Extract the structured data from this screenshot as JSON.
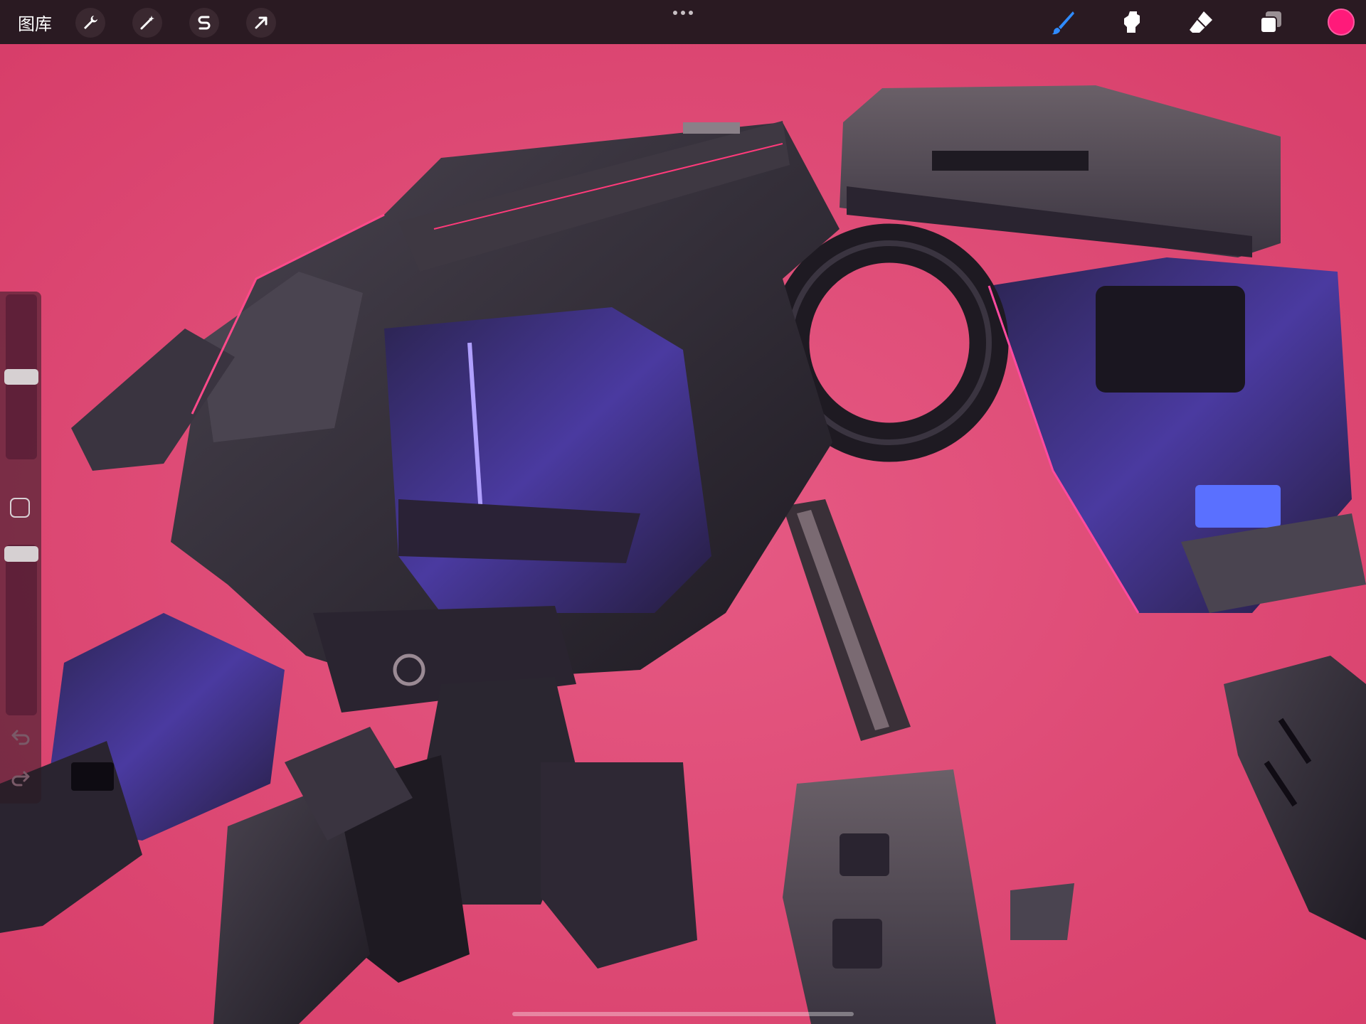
{
  "toolbar": {
    "gallery_label": "图库",
    "left_tools": [
      {
        "icon": "wrench-icon"
      },
      {
        "icon": "magic-wand-icon"
      },
      {
        "icon": "selection-s-icon"
      },
      {
        "icon": "transform-arrow-icon"
      }
    ],
    "more_icon": "ellipsis-icon",
    "right_tools": [
      {
        "icon": "brush-icon",
        "active": true
      },
      {
        "icon": "smudge-icon",
        "active": false
      },
      {
        "icon": "eraser-icon",
        "active": false
      },
      {
        "icon": "layers-icon",
        "active": false
      }
    ],
    "current_color": "#ff1a7a"
  },
  "sidebar": {
    "brush_size_level": 0.5,
    "opacity_level": 0.05,
    "modify_icon": "square-icon",
    "undo_icon": "undo-icon",
    "redo_icon": "redo-icon"
  },
  "canvas": {
    "background_color": "#d9426f",
    "subject": "mech-robot-artwork"
  },
  "colors": {
    "toolbar_bg": "#2a1a22",
    "accent_blue": "#2f8bff",
    "robot_dark": "#2a2630",
    "robot_purple": "#3b2f72"
  }
}
